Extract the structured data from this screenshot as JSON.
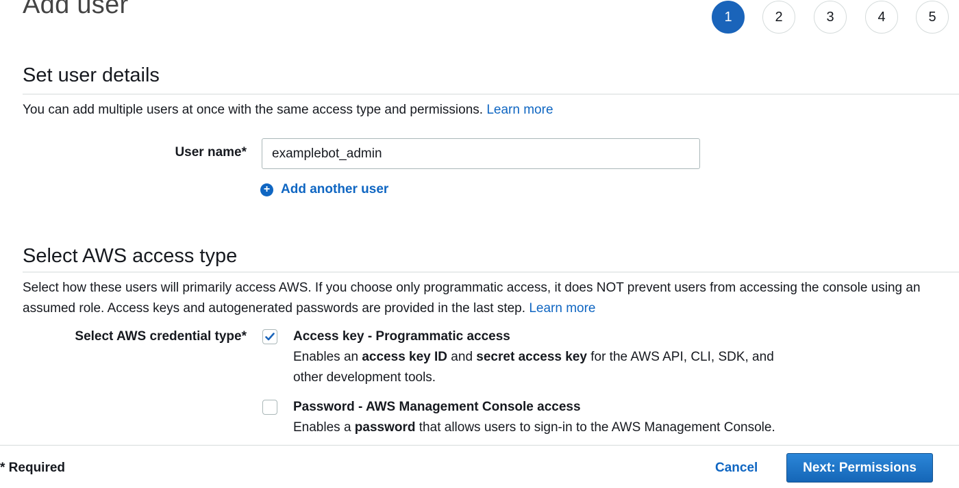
{
  "page_title": "Add user",
  "steps": [
    "1",
    "2",
    "3",
    "4",
    "5"
  ],
  "active_step": "1",
  "details": {
    "title": "Set user details",
    "description": "You can add multiple users at once with the same access type and permissions.",
    "learn_more": "Learn more",
    "user_name_label": "User name*",
    "user_name_value": "examplebot_admin",
    "add_another_user": "Add another user"
  },
  "access": {
    "title": "Select AWS access type",
    "description": "Select how these users will primarily access AWS. If you choose only programmatic access, it does NOT prevent users from accessing the console using an assumed role. Access keys and autogenerated passwords are provided in the last step.",
    "learn_more": "Learn more",
    "credential_label": "Select AWS credential type*",
    "options": [
      {
        "title": "Access key - Programmatic access",
        "checked": true,
        "desc_parts": [
          "Enables an ",
          "access key ID",
          " and ",
          "secret access key",
          " for the AWS API, CLI, SDK, and",
          "other development tools."
        ]
      },
      {
        "title": "Password - AWS Management Console access",
        "checked": false,
        "desc_parts": [
          "Enables a ",
          "password",
          " that allows users to sign-in to the AWS Management Console."
        ]
      }
    ]
  },
  "footer": {
    "required": "* Required",
    "cancel": "Cancel",
    "next": "Next: Permissions"
  },
  "colors": {
    "accent": "#0f66c2",
    "active_step": "#1a64ba"
  }
}
